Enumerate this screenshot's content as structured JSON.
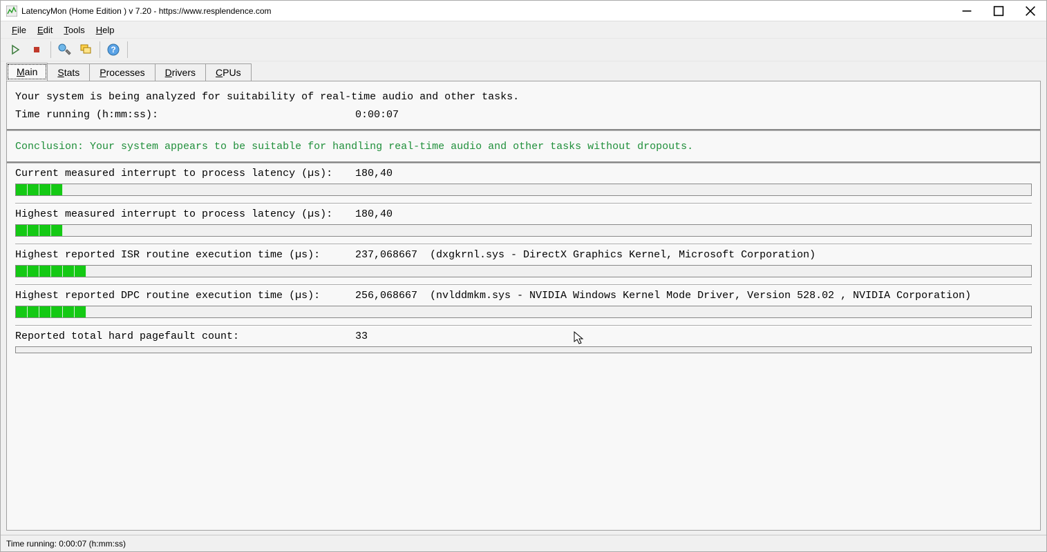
{
  "title": "LatencyMon  (Home Edition )  v 7.20 - https://www.resplendence.com",
  "menus": [
    "File",
    "Edit",
    "Tools",
    "Help"
  ],
  "toolbar": {
    "play": "start-icon",
    "stop": "stop-icon",
    "tools": "tools-icon",
    "windows": "windows-icon",
    "help": "help-icon"
  },
  "tabs": [
    "Main",
    "Stats",
    "Processes",
    "Drivers",
    "CPUs"
  ],
  "active_tab": 0,
  "header": {
    "line1": "Your system is being analyzed for suitability of real-time audio and other tasks.",
    "line2_label": "Time running (h:mm:ss):",
    "line2_value": "0:00:07"
  },
  "conclusion": {
    "prefix": "Conclusion: ",
    "text": "Your system appears to be suitable for handling real-time audio and other tasks without dropouts."
  },
  "metrics": [
    {
      "label": "Current measured interrupt to process latency (µs):",
      "value": "180,40",
      "driver": "",
      "segments": 4
    },
    {
      "label": "Highest measured interrupt to process latency (µs):",
      "value": "180,40",
      "driver": "",
      "segments": 4
    },
    {
      "label": "Highest reported ISR routine execution time (µs):",
      "value": "237,068667",
      "driver": "(dxgkrnl.sys - DirectX Graphics Kernel, Microsoft Corporation)",
      "segments": 6
    },
    {
      "label": "Highest reported DPC routine execution time (µs):",
      "value": "256,068667",
      "driver": "(nvlddmkm.sys - NVIDIA Windows Kernel Mode Driver, Version 528.02 , NVIDIA Corporation)",
      "segments": 6
    },
    {
      "label": "Reported total hard pagefault count:",
      "value": "33",
      "driver": "",
      "segments": 0
    }
  ],
  "statusbar": "Time running: 0:00:07  (h:mm:ss)"
}
